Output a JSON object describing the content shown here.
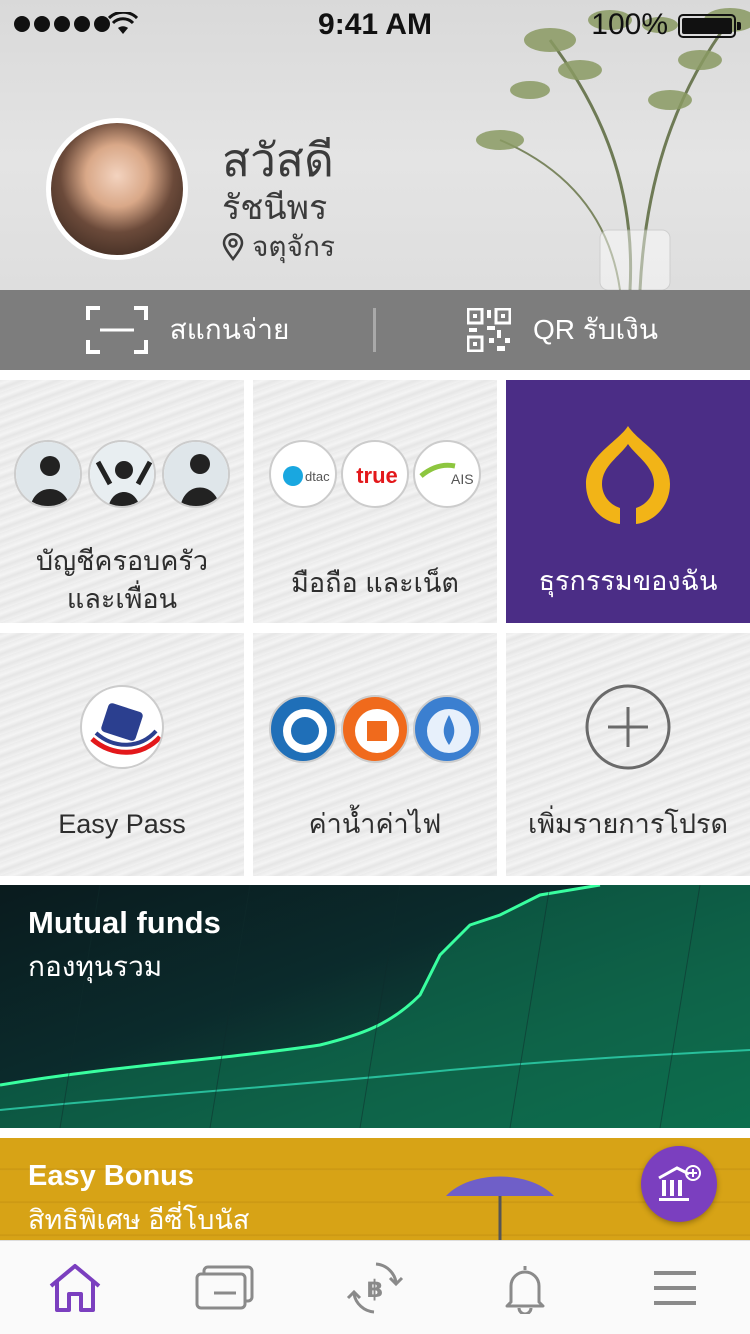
{
  "status_bar": {
    "time": "9:41 AM",
    "battery": "100%"
  },
  "profile": {
    "greeting": "สวัสดี",
    "name": "รัชนีพร",
    "location": "จตุจักร"
  },
  "quick_actions": {
    "scan_pay": "สแกนจ่าย",
    "qr_receive": "QR รับเงิน"
  },
  "tiles": [
    {
      "label_line1": "บัญชีครอบครัว",
      "label_line2": "และเพื่อน"
    },
    {
      "label": "มือถือ และเน็ต",
      "logos": [
        "dtac",
        "true",
        "AIS"
      ]
    },
    {
      "label": "ธุรกรรมของฉัน"
    },
    {
      "label": "Easy Pass"
    },
    {
      "label": "ค่าน้ำค่าไฟ"
    },
    {
      "label": "เพิ่มรายการโปรด"
    }
  ],
  "banners": {
    "mutual_funds": {
      "title": "Mutual funds",
      "subtitle": "กองทุนรวม"
    },
    "easy_bonus": {
      "title": "Easy Bonus",
      "subtitle": "สิทธิพิเศษ อีซี่โบนัส"
    }
  },
  "tab_bar": {
    "active": "home",
    "items": [
      "home-icon",
      "card-icon",
      "baht-exchange-icon",
      "bell-icon",
      "menu-icon"
    ]
  },
  "colors": {
    "brand_purple": "#4b2d86",
    "accent_purple": "#7b3fbf",
    "gold": "#d7a316",
    "scan_bar": "#7d7d7d"
  }
}
